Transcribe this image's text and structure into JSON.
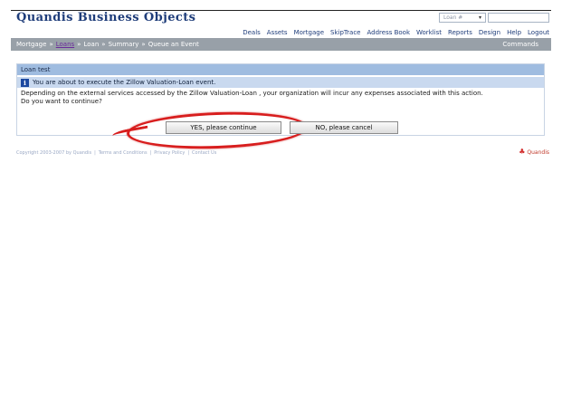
{
  "app": {
    "title": "Quandis Business Objects"
  },
  "search": {
    "type_value": "Loan #",
    "query": ""
  },
  "top_nav": [
    "Deals",
    "Assets",
    "Mortgage",
    "SkipTrace",
    "Address Book",
    "Worklist",
    "Reports",
    "Design",
    "Help",
    "Logout"
  ],
  "breadcrumb": [
    "Mortgage",
    "Loans",
    "Loan",
    "Summary",
    "Queue an Event"
  ],
  "commands_label": "Commands",
  "panel": {
    "title": "Loan test",
    "notice": "You are about to execute the Zillow Valuation-Loan event.",
    "message": "Depending on the external services accessed by the Zillow Valuation-Loan , your organization will incur any expenses associated with this action.",
    "question": "Do you want to continue?"
  },
  "buttons": {
    "yes": "YES, please continue",
    "no": "NO, please cancel"
  },
  "footer": {
    "copyright": "Copyright 2003-2007 by Quandis",
    "links": [
      "Terms and Conditions",
      "Privacy Policy",
      "Contact Us"
    ],
    "logo": "Quandis"
  },
  "colors": {
    "brand": "#1f3d7a",
    "highlight": "#d81e1e",
    "sub_bar": "#98a0a8",
    "panel_header": "#9fbce0"
  }
}
